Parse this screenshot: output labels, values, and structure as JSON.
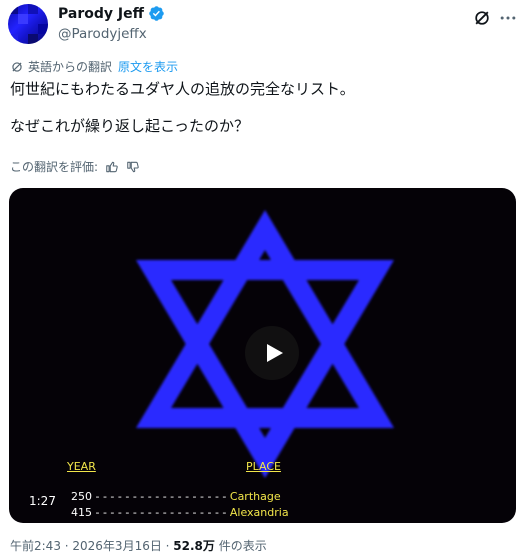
{
  "author": {
    "display_name": "Parody Jeff",
    "handle": "@Parodyjeffx",
    "verified_icon": "verified-badge-icon"
  },
  "header_icons": [
    "grok-icon",
    "more-icon"
  ],
  "translation": {
    "label": "英語からの翻訳",
    "show_original": "原文を表示"
  },
  "tweet": {
    "line1": "何世紀にもわたるユダヤ人の追放の完全なリスト。",
    "line2": "なぜこれが繰り返し起こったのか？"
  },
  "rate_translation": {
    "label": "この翻訳を評価:"
  },
  "video": {
    "duration": "1:27",
    "col_year": "YEAR",
    "col_place": "PLACE",
    "rows": [
      {
        "year": "250",
        "dashes": " - - - - - - - - - - - - - - - - - - ",
        "place": "Carthage"
      },
      {
        "year": "415",
        "dashes": " - - - - - - - - - - - - - - - - - - ",
        "place": "Alexandria"
      }
    ],
    "star_color": "#2a2cff"
  },
  "meta": {
    "time_date": "午前2:43 · 2026年3月16日 · ",
    "views": "52.8万",
    "views_suffix": " 件の表示"
  }
}
